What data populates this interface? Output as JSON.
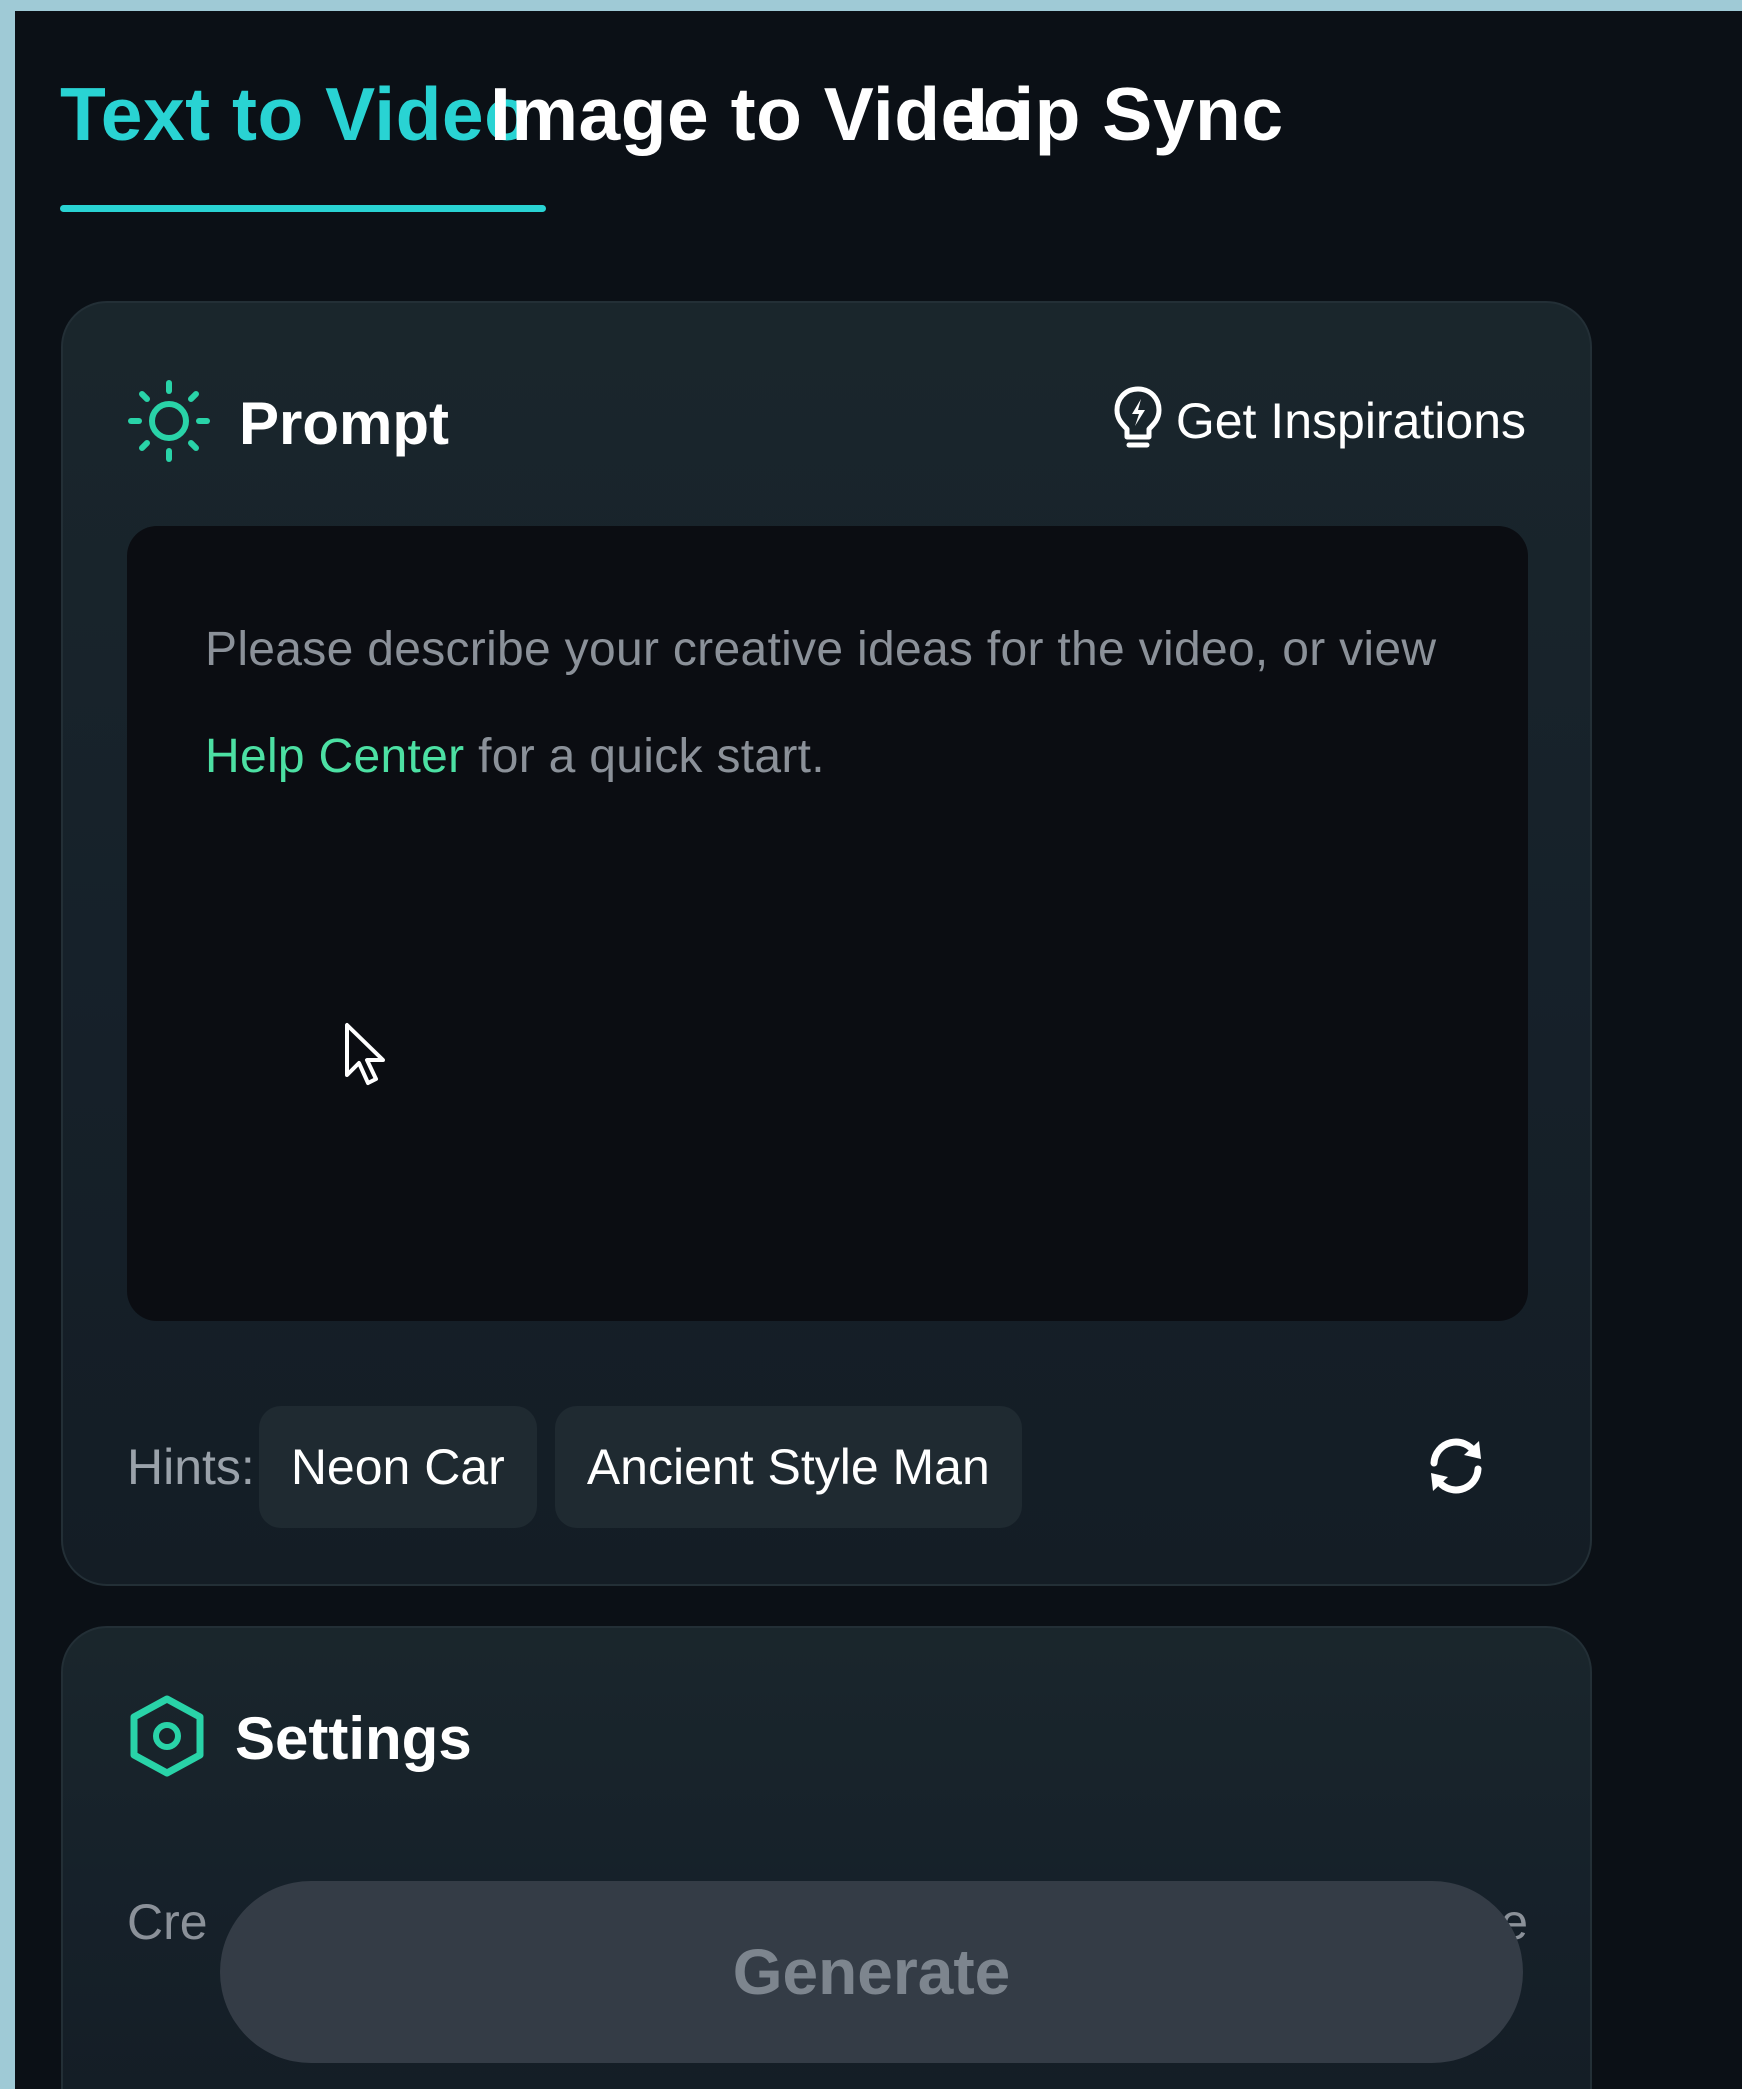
{
  "tabs": [
    {
      "label": "Text to Video",
      "active": true
    },
    {
      "label": "Image to Video",
      "active": false
    },
    {
      "label": "Lip Sync",
      "active": false
    }
  ],
  "prompt": {
    "title": "Prompt",
    "icon": "sun-icon",
    "inspirations_label": "Get Inspirations",
    "inspirations_icon": "lightbulb-icon",
    "placeholder_part1": "Please describe your creative ideas for the video, or view",
    "help_link": "Help Center",
    "placeholder_part2": "for a quick start."
  },
  "hints": {
    "label": "Hints:",
    "chips": [
      "Neon Car",
      "Ancient Style Man"
    ],
    "refresh_icon": "refresh-icon"
  },
  "settings": {
    "title": "Settings",
    "icon": "hexagon-settings-icon",
    "row_left_partial": "Cre",
    "row_right_partial": "e"
  },
  "generate": {
    "label": "Generate"
  },
  "colors": {
    "accent": "#29d3d3",
    "link": "#4ce0a3",
    "background": "#0b1016",
    "card": "#18232a"
  }
}
